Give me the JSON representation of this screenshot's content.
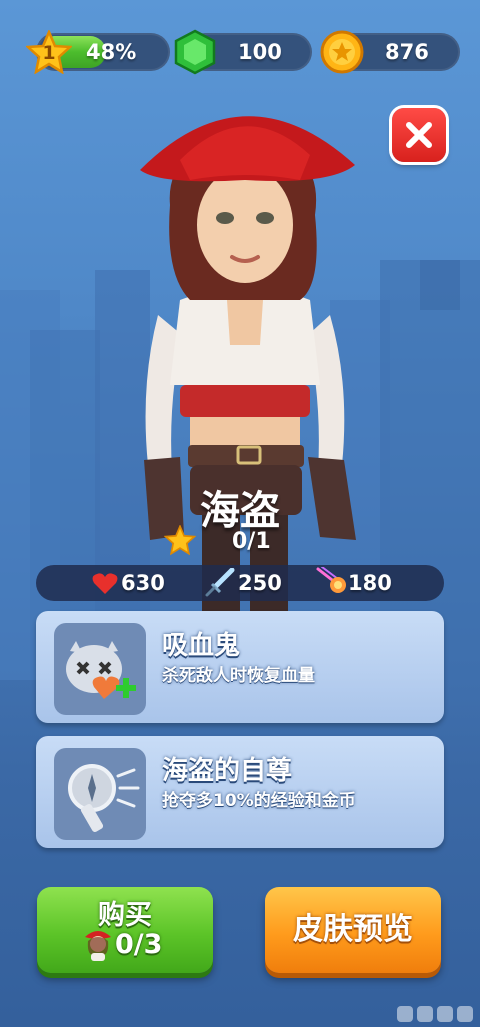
{
  "top_bar": {
    "level": "1",
    "level_progress": "48%",
    "level_progress_fraction": 0.48,
    "gems": "100",
    "coins": "876"
  },
  "hero": {
    "name": "海盗",
    "stars": "0/1"
  },
  "stats": {
    "health": "630",
    "attack": "250",
    "speed": "180"
  },
  "skills": [
    {
      "title": "吸血鬼",
      "description": "杀死敌人时恢复血量",
      "icon": "vampire-heal-icon"
    },
    {
      "title": "海盗的自尊",
      "description": "抢夺多10%的经验和金币",
      "icon": "flashlight-compass-icon"
    }
  ],
  "buttons": {
    "buy_label": "购买",
    "buy_count": "0/3",
    "skin_preview_label": "皮肤预览"
  },
  "colors": {
    "accent_green": "#5cc428",
    "accent_orange": "#ff9b1c",
    "close_red": "#d8211d"
  }
}
